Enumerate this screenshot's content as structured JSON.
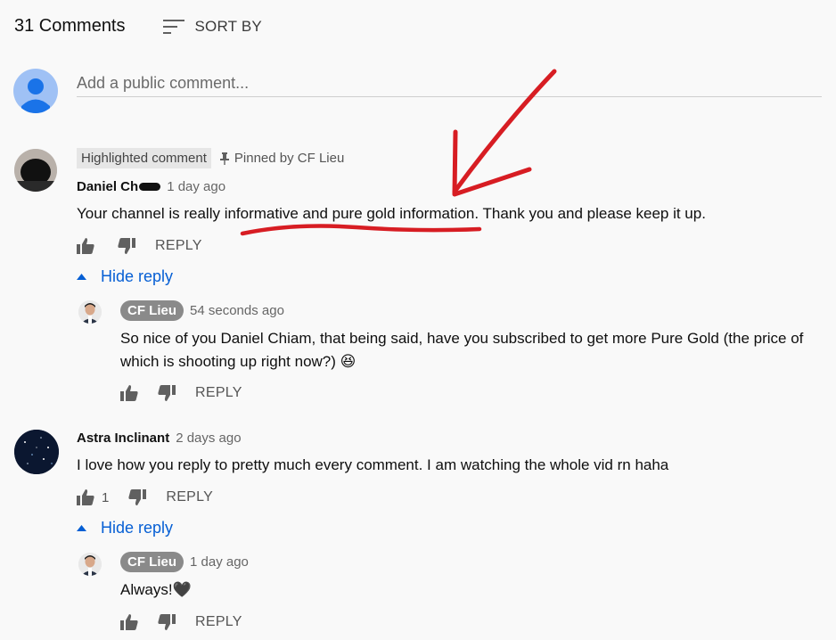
{
  "header": {
    "comment_count": "31 Comments",
    "sort_label": "SORT BY",
    "sort_icon": "sort-icon"
  },
  "add_comment": {
    "placeholder": "Add a public comment..."
  },
  "comments": [
    {
      "highlight_label": "Highlighted comment",
      "pinned_label": "Pinned by CF Lieu",
      "author": "Daniel Ch",
      "time": "1 day ago",
      "text": "Your channel is really informative and pure gold information. Thank you and please keep it up.",
      "likes": "",
      "reply_label": "REPLY",
      "hide_reply_label": "Hide reply",
      "reply": {
        "author": "CF Lieu",
        "time": "54 seconds ago",
        "text_line1": "So nice of you Daniel Chiam, that being said, have you subscribed to get more Pure Gold (the price of",
        "text_line2": "which is shooting up right now?) 😆",
        "reply_label": "REPLY"
      }
    },
    {
      "author": "Astra Inclinant",
      "time": "2 days ago",
      "text": "I love how you reply to pretty much every comment. I am watching the whole vid rn haha",
      "likes": "1",
      "reply_label": "REPLY",
      "hide_reply_label": "Hide reply",
      "reply": {
        "author": "CF Lieu",
        "time": "1 day ago",
        "text": "Always!🖤",
        "reply_label": "REPLY"
      }
    }
  ],
  "colors": {
    "link_blue": "#065fd4",
    "annotation_red": "#d71d23",
    "chip_gray": "#8a8a8a",
    "avatar_blue": "#9fc1f5"
  }
}
